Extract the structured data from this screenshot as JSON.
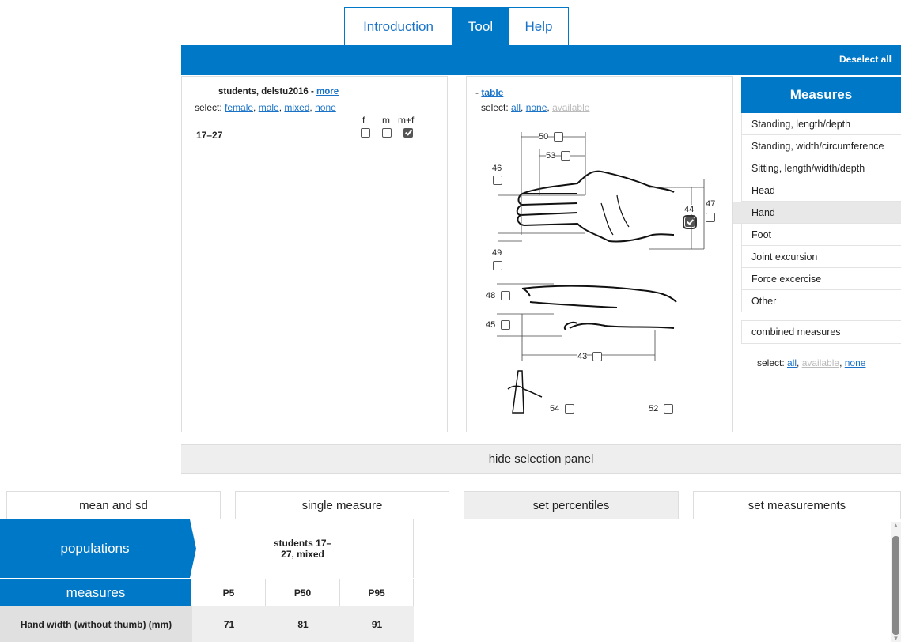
{
  "top_tabs": [
    {
      "label": "Introduction",
      "active": false
    },
    {
      "label": "Tool",
      "active": true
    },
    {
      "label": "Help",
      "active": false
    }
  ],
  "toolbar": {
    "deselect_label": "Deselect all"
  },
  "population_panel": {
    "title": "students, delstu2016 - ",
    "more_link": "more",
    "select_label": "select: ",
    "select_options": [
      "female",
      "male",
      "mixed",
      "none"
    ],
    "column_headers": [
      "f",
      "m",
      "m+f"
    ],
    "rows": [
      {
        "label": "17–27",
        "f": false,
        "m": false,
        "mf": true
      }
    ]
  },
  "diagram_panel": {
    "table_prefix": "- ",
    "table_link": "table",
    "select_label": "select: ",
    "select_all": "all",
    "select_none": "none",
    "select_available": "available",
    "measure_checkboxes": [
      {
        "num": "50",
        "checked": false
      },
      {
        "num": "53",
        "checked": false
      },
      {
        "num": "46",
        "checked": false
      },
      {
        "num": "47",
        "checked": false
      },
      {
        "num": "44",
        "checked": true
      },
      {
        "num": "49",
        "checked": false
      },
      {
        "num": "48",
        "checked": false
      },
      {
        "num": "45",
        "checked": false
      },
      {
        "num": "43",
        "checked": false
      },
      {
        "num": "54",
        "checked": false
      },
      {
        "num": "52",
        "checked": false
      }
    ]
  },
  "measures_panel": {
    "header": "Measures",
    "items": [
      "Standing, length/depth",
      "Standing, width/circumference",
      "Sitting, length/width/depth",
      "Head",
      "Hand",
      "Foot",
      "Joint excursion",
      "Force excercise",
      "Other"
    ],
    "selected": "Hand",
    "combined": "combined measures",
    "select_label": "select: ",
    "select_all": "all",
    "select_available": "available",
    "select_none": "none"
  },
  "hide_panel_label": "hide selection panel",
  "bottom_tabs": [
    "mean and sd",
    "single measure",
    "set percentiles",
    "set measurements"
  ],
  "results_table": {
    "populations_label": "populations",
    "population_name": "students 17–\n27, mixed",
    "measures_label": "measures",
    "percentile_headers": [
      "P5",
      "P50",
      "P95"
    ],
    "rows": [
      {
        "measure": "Hand width (without thumb) (mm)",
        "values": [
          "71",
          "81",
          "91"
        ]
      }
    ]
  },
  "colors": {
    "accent": "#0078c8",
    "link": "#1a73c8",
    "disabled": "#bbbbbb",
    "selected_bg": "#e8e8e8"
  }
}
